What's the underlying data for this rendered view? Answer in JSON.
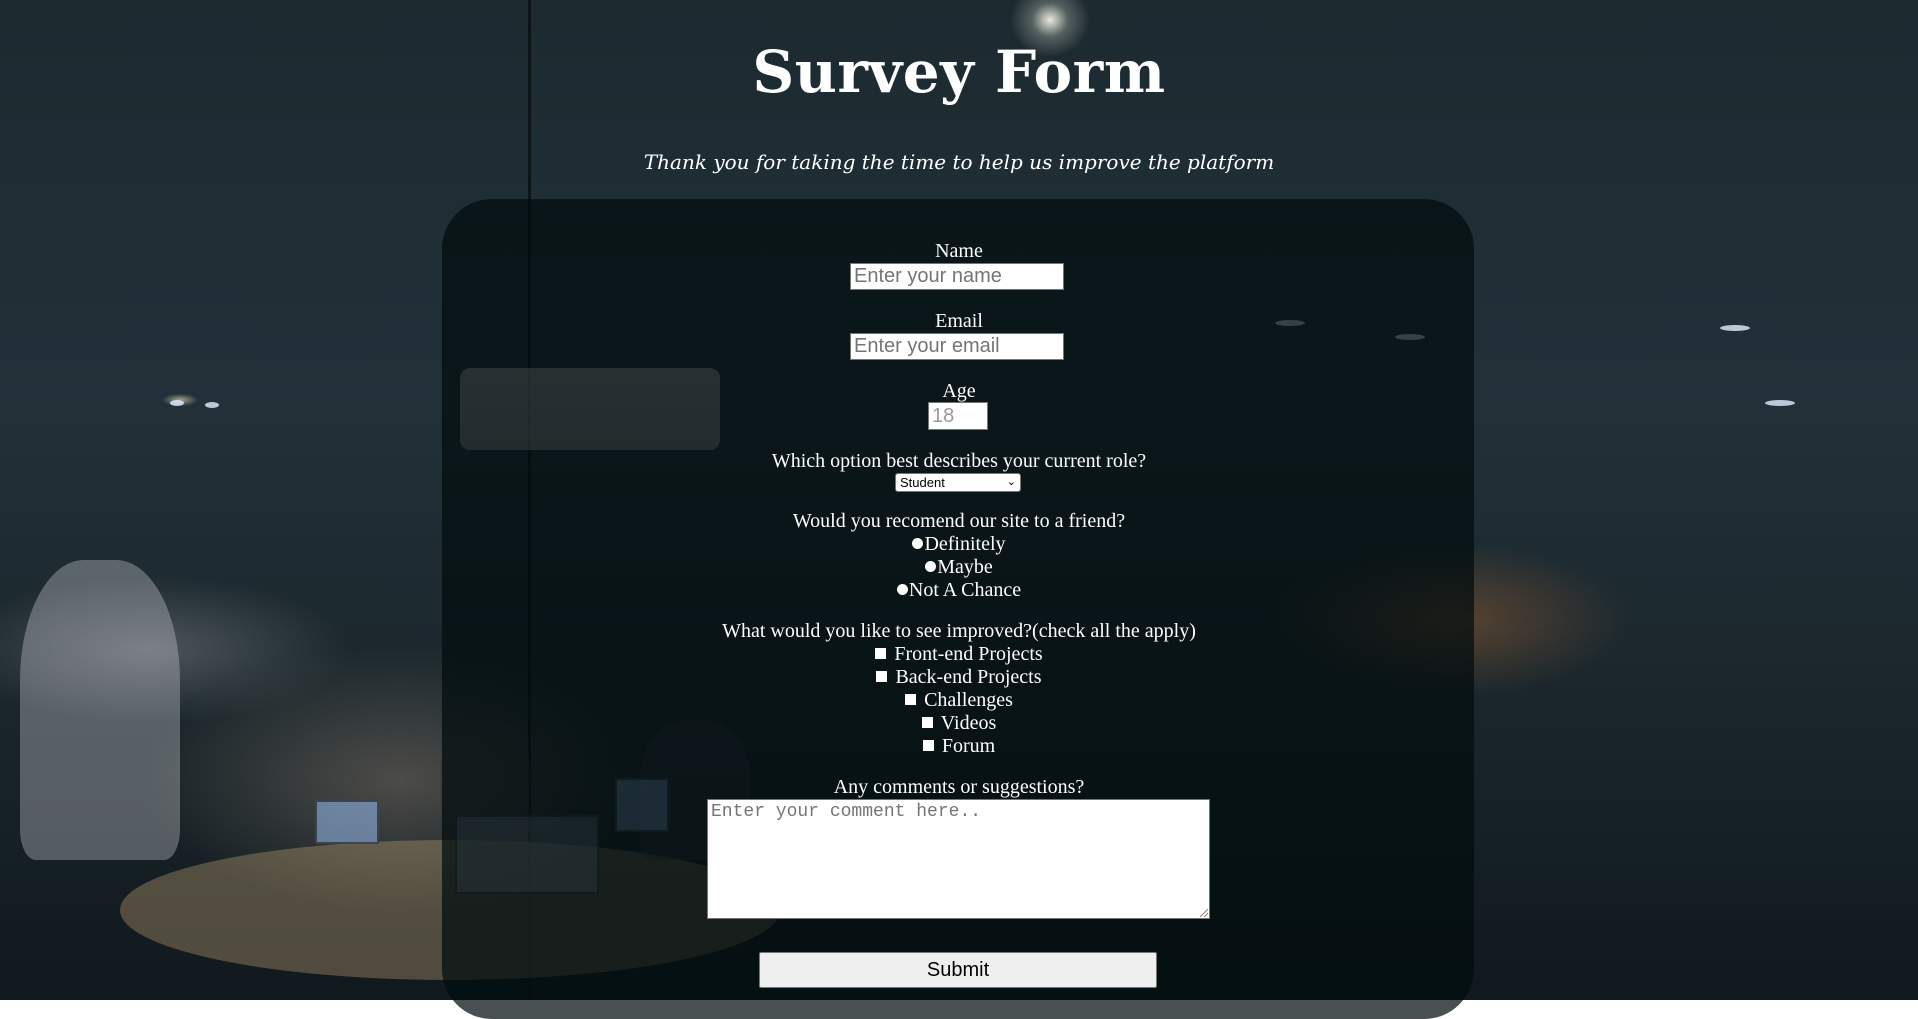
{
  "header": {
    "title": "Survey Form",
    "description": "Thank you for taking the time to help us improve the platform"
  },
  "form": {
    "name": {
      "label": "Name",
      "placeholder": "Enter your name",
      "value": ""
    },
    "email": {
      "label": "Email",
      "placeholder": "Enter your email",
      "value": ""
    },
    "age": {
      "label": "Age",
      "placeholder": "18",
      "value": ""
    },
    "role": {
      "label": "Which option best describes your current role?",
      "selected": "Student"
    },
    "recommend": {
      "label": "Would you recomend our site to a friend?",
      "options": [
        "Definitely",
        "Maybe",
        "Not A Chance"
      ]
    },
    "improvements": {
      "label": "What would you like to see improved?(check all the apply)",
      "options": [
        "Front-end Projects",
        "Back-end Projects",
        "Challenges",
        "Videos",
        "Forum"
      ]
    },
    "comments": {
      "label": "Any comments or suggestions?",
      "placeholder": "Enter your comment here.."
    },
    "submit_label": "Submit"
  },
  "icons": {
    "select_chevron": "chevron-down-icon",
    "radio": "radio-button-icon",
    "checkbox": "checkbox-icon",
    "resize_grip": "resize-handle-icon"
  },
  "colors": {
    "panel_background": "#020c0e",
    "text": "#ffffff",
    "button_background": "#efefef"
  }
}
